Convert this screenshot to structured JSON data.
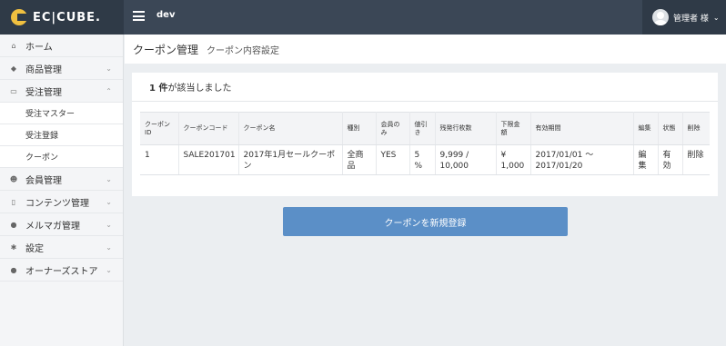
{
  "header": {
    "logo_text": "EC|CUBE.",
    "site_name": "dev",
    "user_name": "管理者 様",
    "user_chevron": "⌄"
  },
  "sidebar": {
    "items": [
      {
        "label": "ホーム",
        "icon": "home-icon",
        "glyph": "⌂",
        "chevron": ""
      },
      {
        "label": "商品管理",
        "icon": "tag-icon",
        "glyph": "◆",
        "chevron": "⌄"
      },
      {
        "label": "受注管理",
        "icon": "cart-icon",
        "glyph": "▭",
        "chevron": "⌃"
      },
      {
        "label": "会員管理",
        "icon": "users-icon",
        "glyph": "☻",
        "chevron": "⌄"
      },
      {
        "label": "コンテンツ管理",
        "icon": "file-icon",
        "glyph": "▯",
        "chevron": "⌄"
      },
      {
        "label": "メルマガ管理",
        "icon": "chat-icon",
        "glyph": "●",
        "chevron": "⌄"
      },
      {
        "label": "設定",
        "icon": "gear-icon",
        "glyph": "✱",
        "chevron": "⌄"
      },
      {
        "label": "オーナーズストア",
        "icon": "info-icon",
        "glyph": "●",
        "chevron": "⌄"
      }
    ],
    "sub_items": [
      "受注マスター",
      "受注登録",
      "クーポン"
    ]
  },
  "page": {
    "title": "クーポン管理",
    "subtitle": "クーポン内容設定"
  },
  "results": {
    "count": "1 件",
    "suffix": " が該当しました"
  },
  "table": {
    "headers": [
      "クーポン ID",
      "クーポンコード",
      "クーポン名",
      "種別",
      "会員のみ",
      "値引き",
      "残発行枚数",
      "下限金額",
      "有効期間",
      "編集",
      "状態",
      "削除"
    ],
    "rows": [
      {
        "id": "1",
        "code": "SALE201701",
        "name": "2017年1月セールクーポン",
        "type": "全商品",
        "member_only": "YES",
        "discount": "5 %",
        "remaining": "9,999 / 10,000",
        "min_amount": "¥ 1,000",
        "period": "2017/01/01 ～ 2017/01/20",
        "edit": "編集",
        "status": "有効",
        "delete": "削除"
      }
    ]
  },
  "actions": {
    "new_coupon": "クーポンを新規登録"
  }
}
